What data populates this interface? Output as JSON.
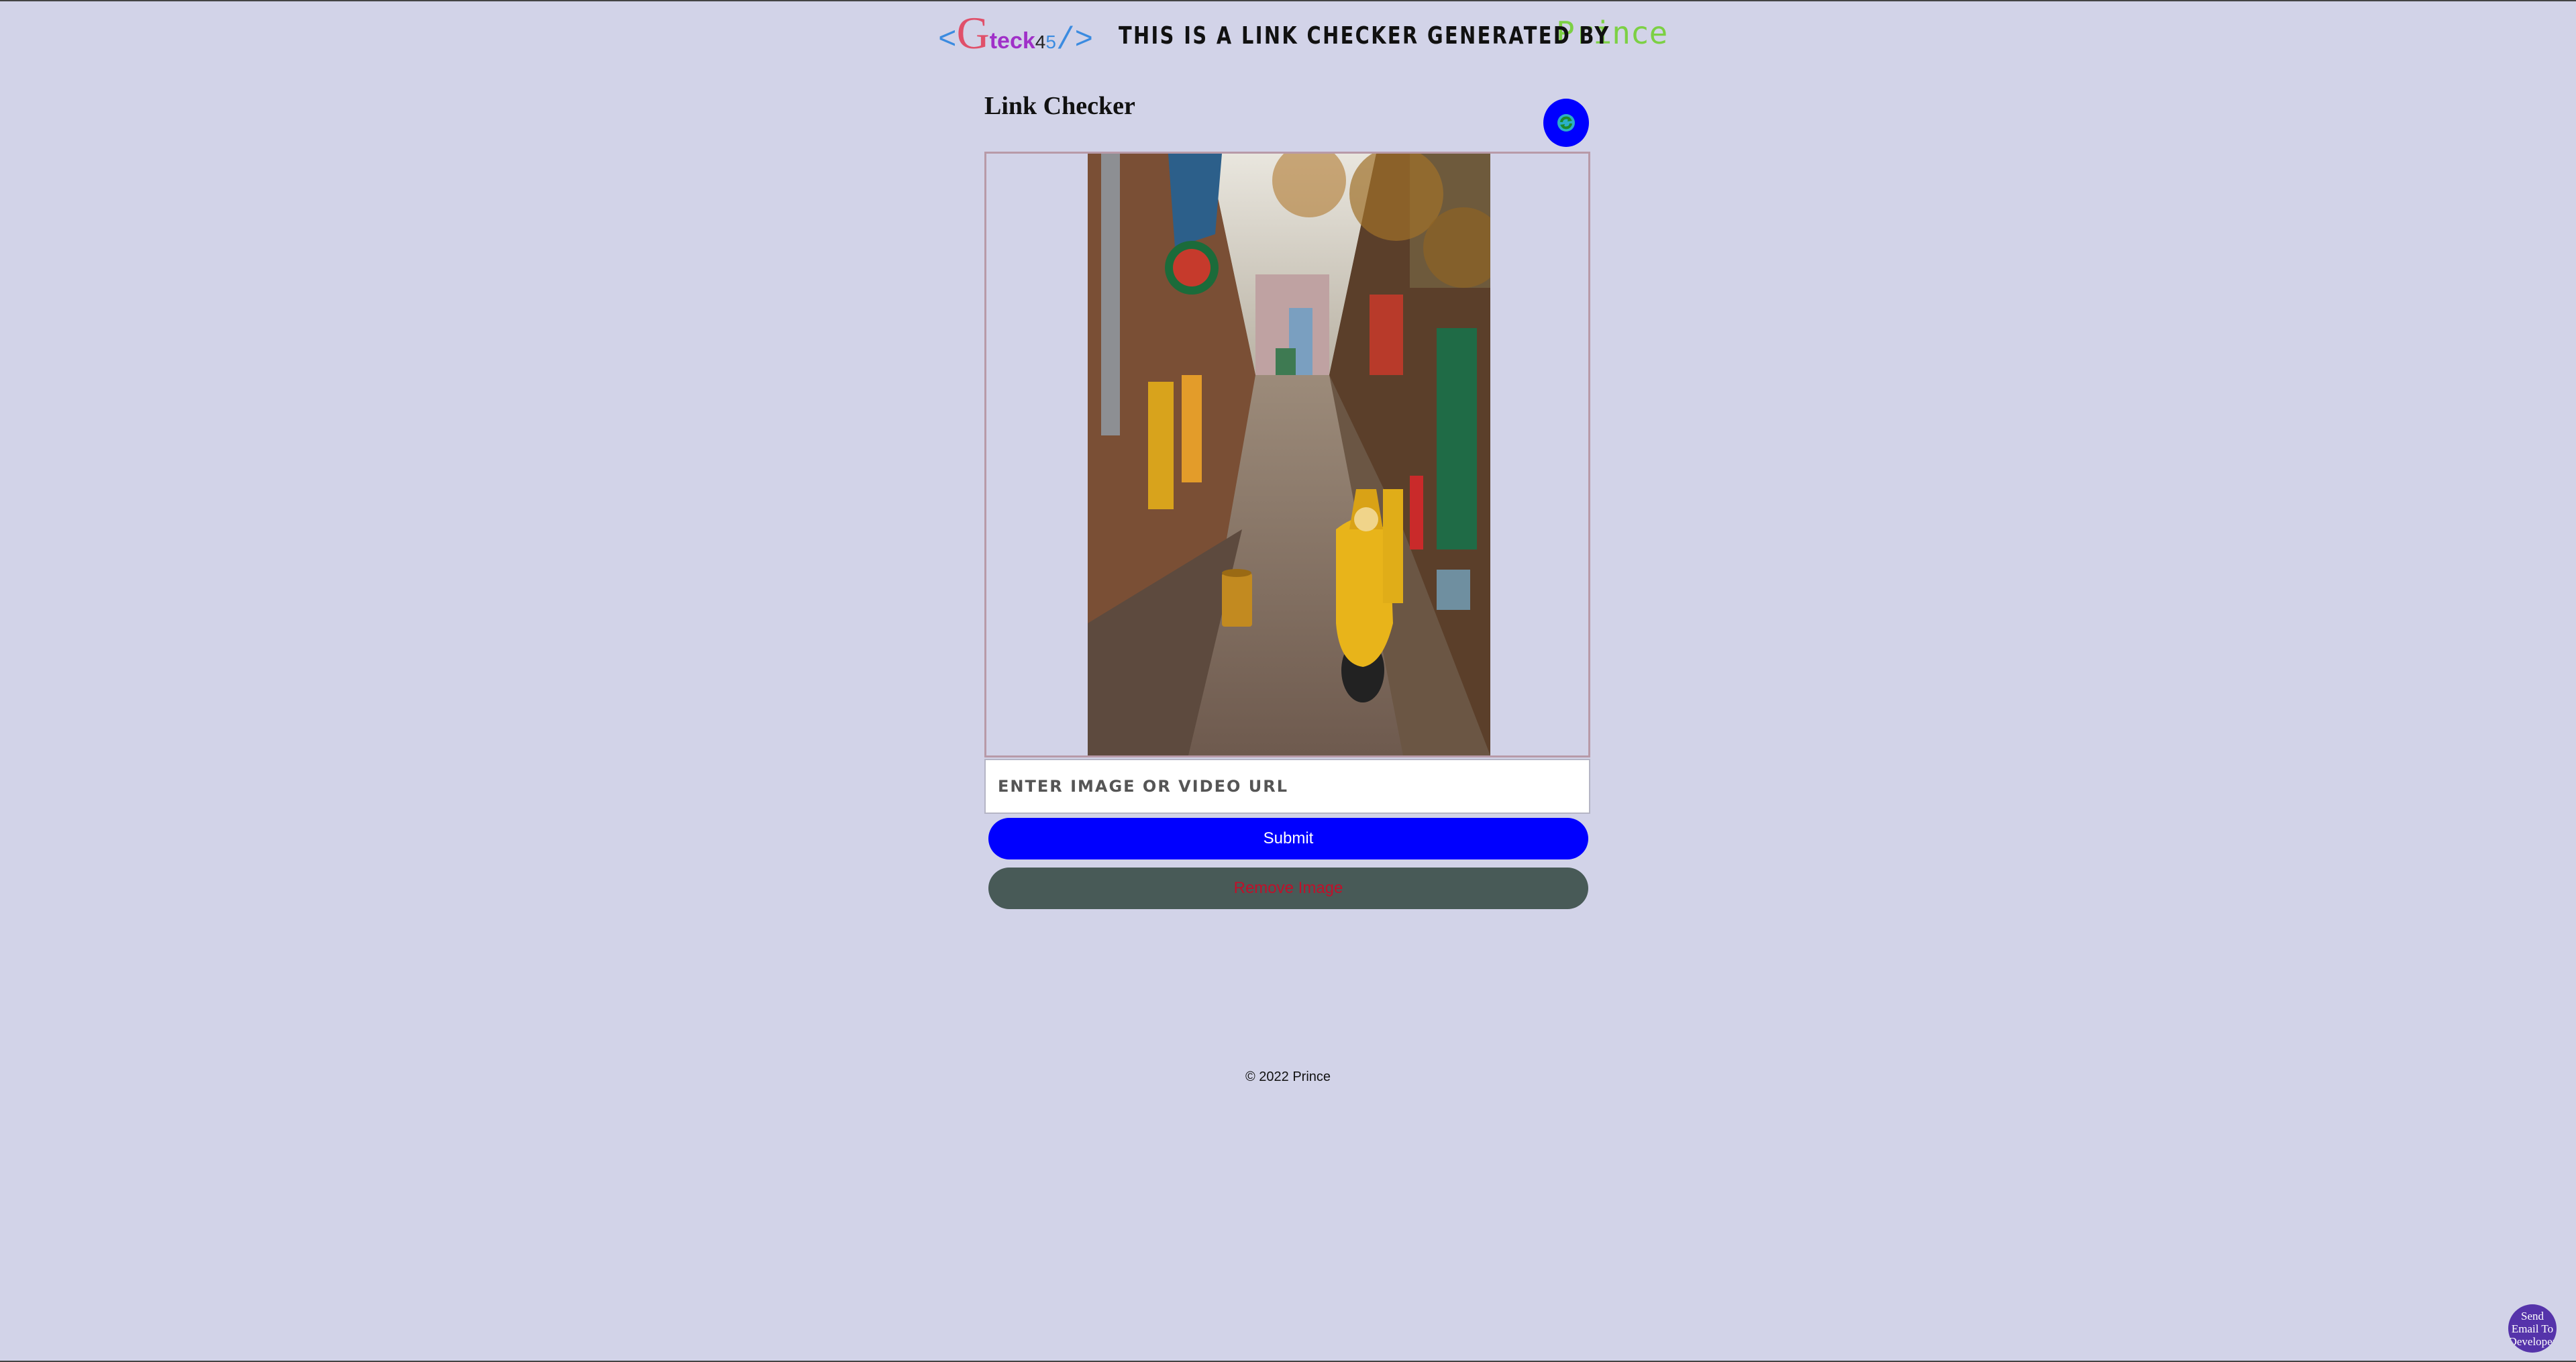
{
  "header": {
    "logo": {
      "open": "<",
      "g": "G",
      "teck": "teck",
      "n4": "4",
      "n5": "5",
      "close": "/>"
    },
    "headline": "THIS IS A LINK CHECKER GENERATED BY",
    "author": "Prince"
  },
  "card": {
    "title": "Link Checker",
    "refresh_icon": "refresh-icon",
    "url_placeholder": "ENTER IMAGE OR VIDEO URL",
    "url_value": "",
    "submit_label": "Submit",
    "remove_label": "Remove Image"
  },
  "footer": {
    "copyright": "© 2022 Prince"
  },
  "email_button": {
    "label": "Send Email To Developer"
  },
  "colors": {
    "background": "#d2d3e8",
    "primary": "#0000ff",
    "remove_bg": "#485a57",
    "remove_text": "#c0102a",
    "author": "#7cd044",
    "email_bubble": "#5533aa"
  }
}
